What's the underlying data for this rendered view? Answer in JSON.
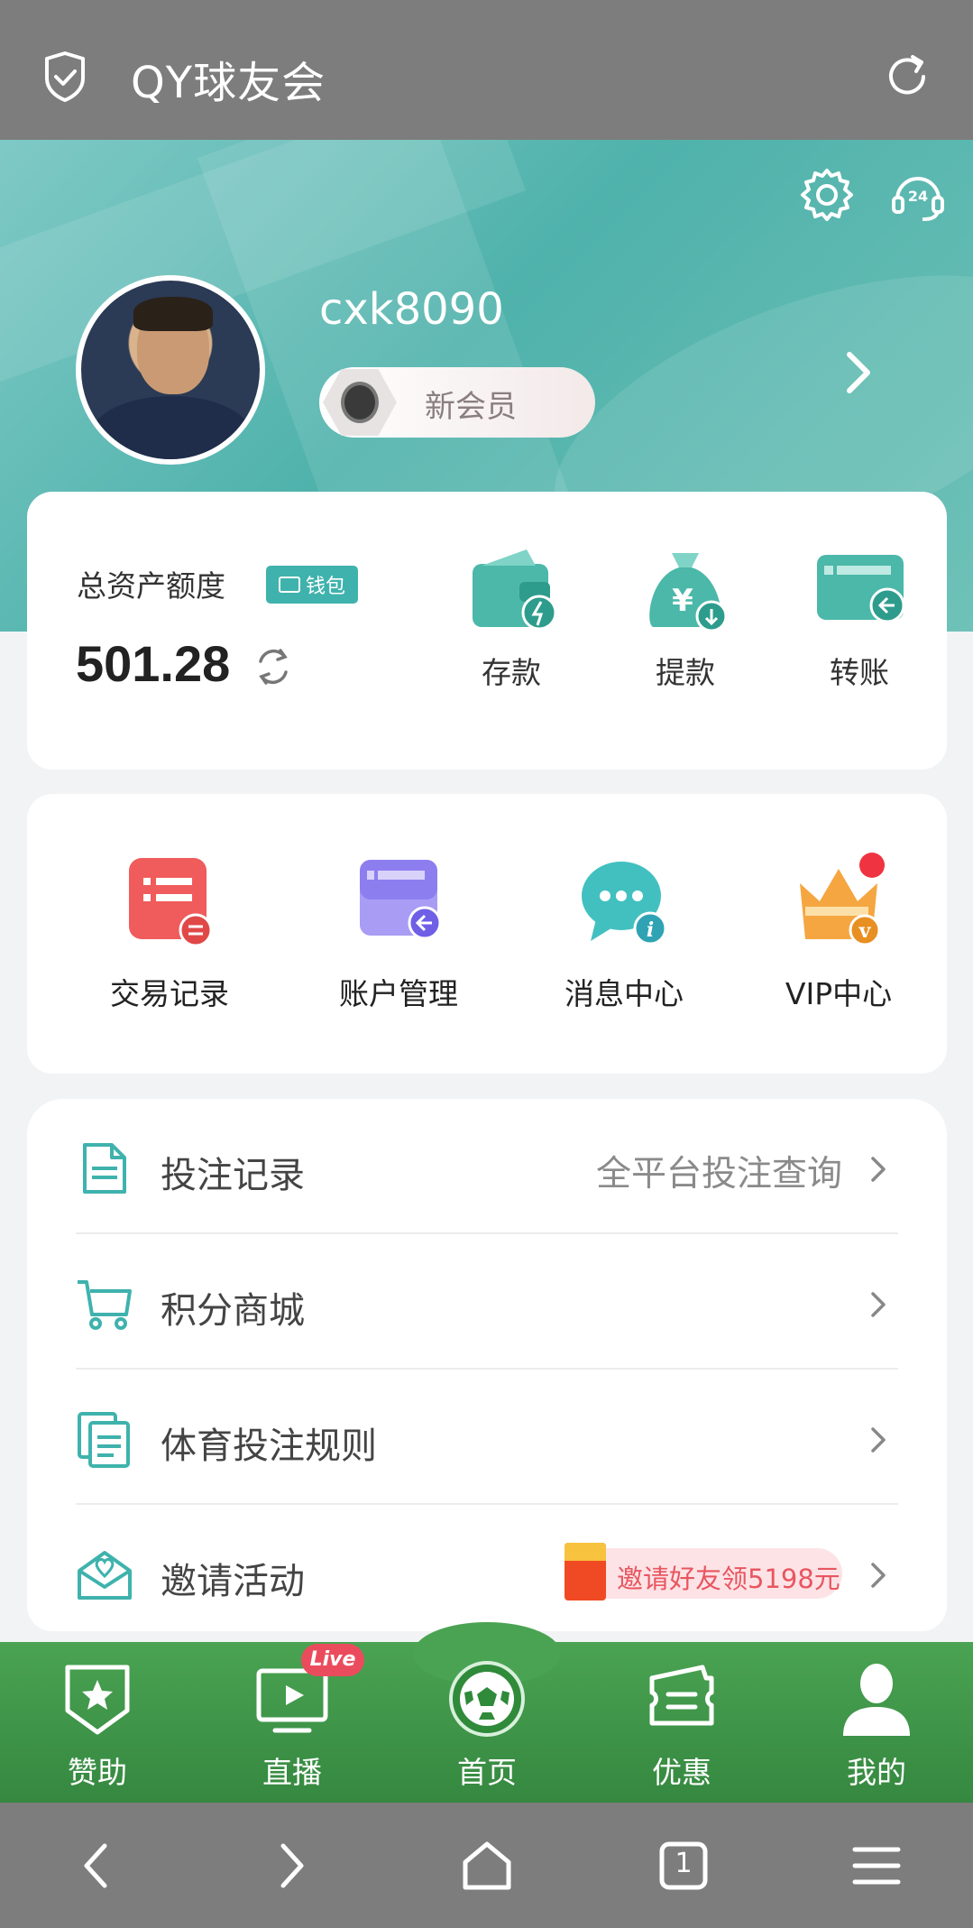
{
  "topbar": {
    "title": "QY球友会"
  },
  "profile": {
    "username": "cxk8090",
    "member_level": "新会员"
  },
  "assets": {
    "label": "总资产额度",
    "wallet_tag": "钱包",
    "amount": "501.28",
    "actions": [
      {
        "label": "存款",
        "icon": "deposit-wallet-icon"
      },
      {
        "label": "提款",
        "icon": "withdraw-moneybag-icon"
      },
      {
        "label": "转账",
        "icon": "transfer-card-icon"
      }
    ]
  },
  "quick_links": [
    {
      "label": "交易记录",
      "icon": "transaction-record-icon"
    },
    {
      "label": "账户管理",
      "icon": "account-card-icon"
    },
    {
      "label": "消息中心",
      "icon": "message-bubble-icon"
    },
    {
      "label": "VIP中心",
      "icon": "vip-crown-icon",
      "has_dot": true
    }
  ],
  "menu": [
    {
      "label": "投注记录",
      "side": "全平台投注查询",
      "icon": "document-icon"
    },
    {
      "label": "积分商城",
      "side": "",
      "icon": "cart-icon"
    },
    {
      "label": "体育投注规则",
      "side": "",
      "icon": "rules-docs-icon"
    },
    {
      "label": "邀请活动",
      "promo": "邀请好友领5198元",
      "icon": "heart-mail-icon"
    }
  ],
  "bottom_nav": [
    {
      "label": "赞助",
      "icon": "star-shield-icon"
    },
    {
      "label": "直播",
      "icon": "live-tv-icon",
      "badge": "Live"
    },
    {
      "label": "首页",
      "icon": "soccer-ball-icon"
    },
    {
      "label": "优惠",
      "icon": "ticket-icon"
    },
    {
      "label": "我的",
      "icon": "user-icon"
    }
  ],
  "browser_bar": {
    "tab_count": "1"
  },
  "colors": {
    "accent": "#3fb2ad",
    "nav_green": "#3e9448",
    "browser_gray": "#7d7d7d"
  }
}
